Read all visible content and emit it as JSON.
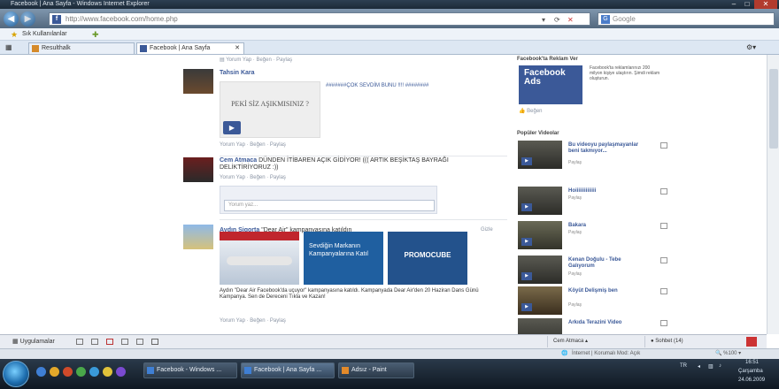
{
  "browser": {
    "title": "Facebook | Ana Sayfa - Windows Internet Explorer",
    "url": "http://www.facebook.com/home.php",
    "search_placeholder": "Google",
    "favorites_label": "Sık Kullanılanlar",
    "tabs": [
      {
        "label": "Resulthalk"
      },
      {
        "label": "Facebook | Ana Sayfa"
      }
    ]
  },
  "feed": {
    "posts": [
      {
        "name": "Tahsin Kara",
        "video_text": "PEKİ SİZ AŞIKMISINIZ ?",
        "share_text": "#######ÇOK SEVDİM BUNU !!!! ########",
        "meta": "Yorum Yap · Beğen · Paylaş"
      },
      {
        "name": "Cem Atmaca",
        "text": "DÜNDEN İTİBAREN AÇIK GİDİYOR! ((( ARTIK BEŞİKTAŞ BAYRAĞI DELİKTİRİYORUZ :))",
        "meta": "Yorum Yap · Beğen · Paylaş",
        "comment_placeholder": "Yorum yaz..."
      },
      {
        "name": "Aydın Sigorta",
        "title_suffix": "\"Dear Air\" kampanyasına katıldın",
        "ad_titles": [
          "Sevdiğin Markanın Kampanyalarına Katıl",
          "PROMOCUBE"
        ],
        "body": "Aydın \"Dear Air Facebook'da uçuyor\" kampanyasına katıldı. Kampanyada Dear Air'den 20 Haziran Dans Günü Kampanya. Sen de Dereceni Tıkla ve Kazan!",
        "meta": "Yorum Yap · Beğen · Paylaş",
        "like_label": "Gizle"
      }
    ]
  },
  "sidebar": {
    "ads_heading": "Facebook'ta Reklam Ver",
    "ads_logo": [
      "Facebook",
      "Ads"
    ],
    "ads_text": "Facebook'ta reklamlarınızı 200 milyon kişiye ulaştırın. Şimdi reklam oluşturun.",
    "ads_like": "Beğen",
    "videos_heading": "Popüler Videolar",
    "videos": [
      {
        "title": "Bu videoyu paylaşmayanlar beni takmıyor...",
        "meta": "Paylaş"
      },
      {
        "title": "Hoiiiiiiiiiiiiii",
        "meta": "Paylaş"
      },
      {
        "title": "Bakara",
        "meta": "Paylaş"
      },
      {
        "title": "Kenan Doğulu - Tebe Galıyorum",
        "meta": "Paylaş"
      },
      {
        "title": "Köyüt Delişmiş ben",
        "meta": "Paylaş"
      },
      {
        "title": "Arkıda Terazini Video",
        "meta": "Paylaş"
      }
    ]
  },
  "chatbar": {
    "apps_label": "Uygulamalar",
    "chat_users": [
      "Cem Atmaca",
      "Sohbet (14)"
    ]
  },
  "statusbar": {
    "zone": "İnternet | Korumalı Mod: Açık",
    "zoom": "%100"
  },
  "taskbar": {
    "buttons": [
      "Facebook - Windows ...",
      "Facebook | Ana Sayfa ...",
      "Adsız - Paint"
    ],
    "lang": "TR",
    "time": "16:51",
    "day": "Çarşamba",
    "date": "24.06.2009"
  }
}
